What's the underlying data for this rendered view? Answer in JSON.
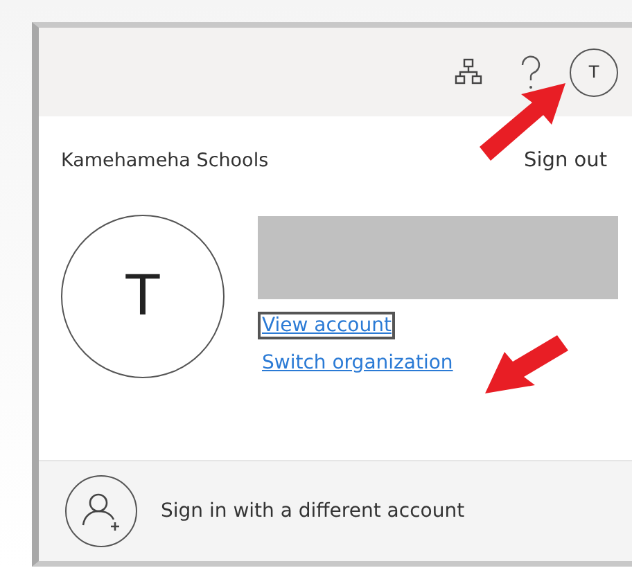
{
  "header": {
    "avatar_initial": "T"
  },
  "account": {
    "organization": "Kamehameha Schools",
    "sign_out": "Sign out",
    "avatar_initial": "T",
    "links": [
      {
        "label": "View account",
        "focused": true
      },
      {
        "label": "Switch organization",
        "focused": false
      }
    ]
  },
  "footer": {
    "label": "Sign in with a different account"
  }
}
